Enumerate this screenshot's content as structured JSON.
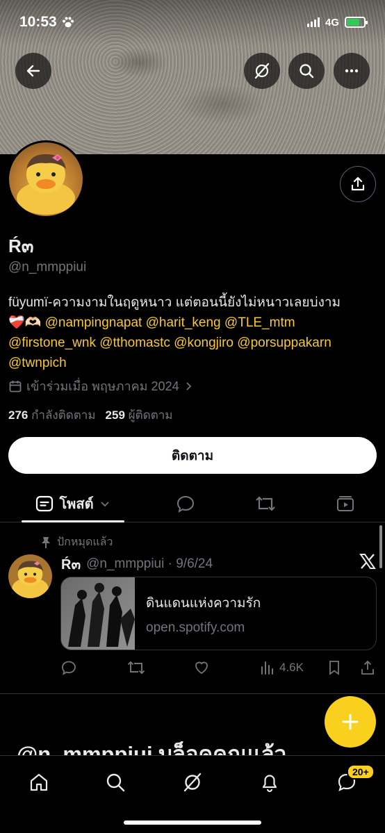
{
  "status_bar": {
    "time": "10:53",
    "network": "4G",
    "battery_percent": 75
  },
  "profile": {
    "name": "Ŕ๓",
    "handle": "@n_mmppiui",
    "bio_text": "füyumï-ความงามในฤดูหนาว แต่ตอนนี้ยังไม่หนาวเลยบ่งาม",
    "bio_emojis": "❤️‍🩹🫶🏻",
    "mentions": [
      "@nampingnapat",
      "@harit_keng",
      "@TLE_mtm",
      "@firstone_wnk",
      "@tthomastc",
      "@kongjiro",
      "@porsuppakarn",
      "@twnpich"
    ],
    "joined": "เข้าร่วมเมื่อ พฤษภาคม 2024",
    "following_count": "276",
    "following_label": "กำลังติดตาม",
    "followers_count": "259",
    "followers_label": "ผู้ติดตาม",
    "follow_button": "ติดตาม"
  },
  "tabs": {
    "posts_label": "โพสต์"
  },
  "tweet": {
    "pinned_label": "ปักหมุดแล้ว",
    "name": "Ŕ๓",
    "handle_date": "@n_mmppiui · 9/6/24",
    "card_title": "ดินแดนแห่งความรัก",
    "card_domain": "open.spotify.com",
    "views": "4.6K"
  },
  "blocked_message": "@n_mmppiui บล็อคคุณแล้ว",
  "nav": {
    "messages_badge": "20+"
  },
  "colors": {
    "accent": "#f7c92b",
    "fab": "#f9d01e",
    "background": "#000000"
  }
}
